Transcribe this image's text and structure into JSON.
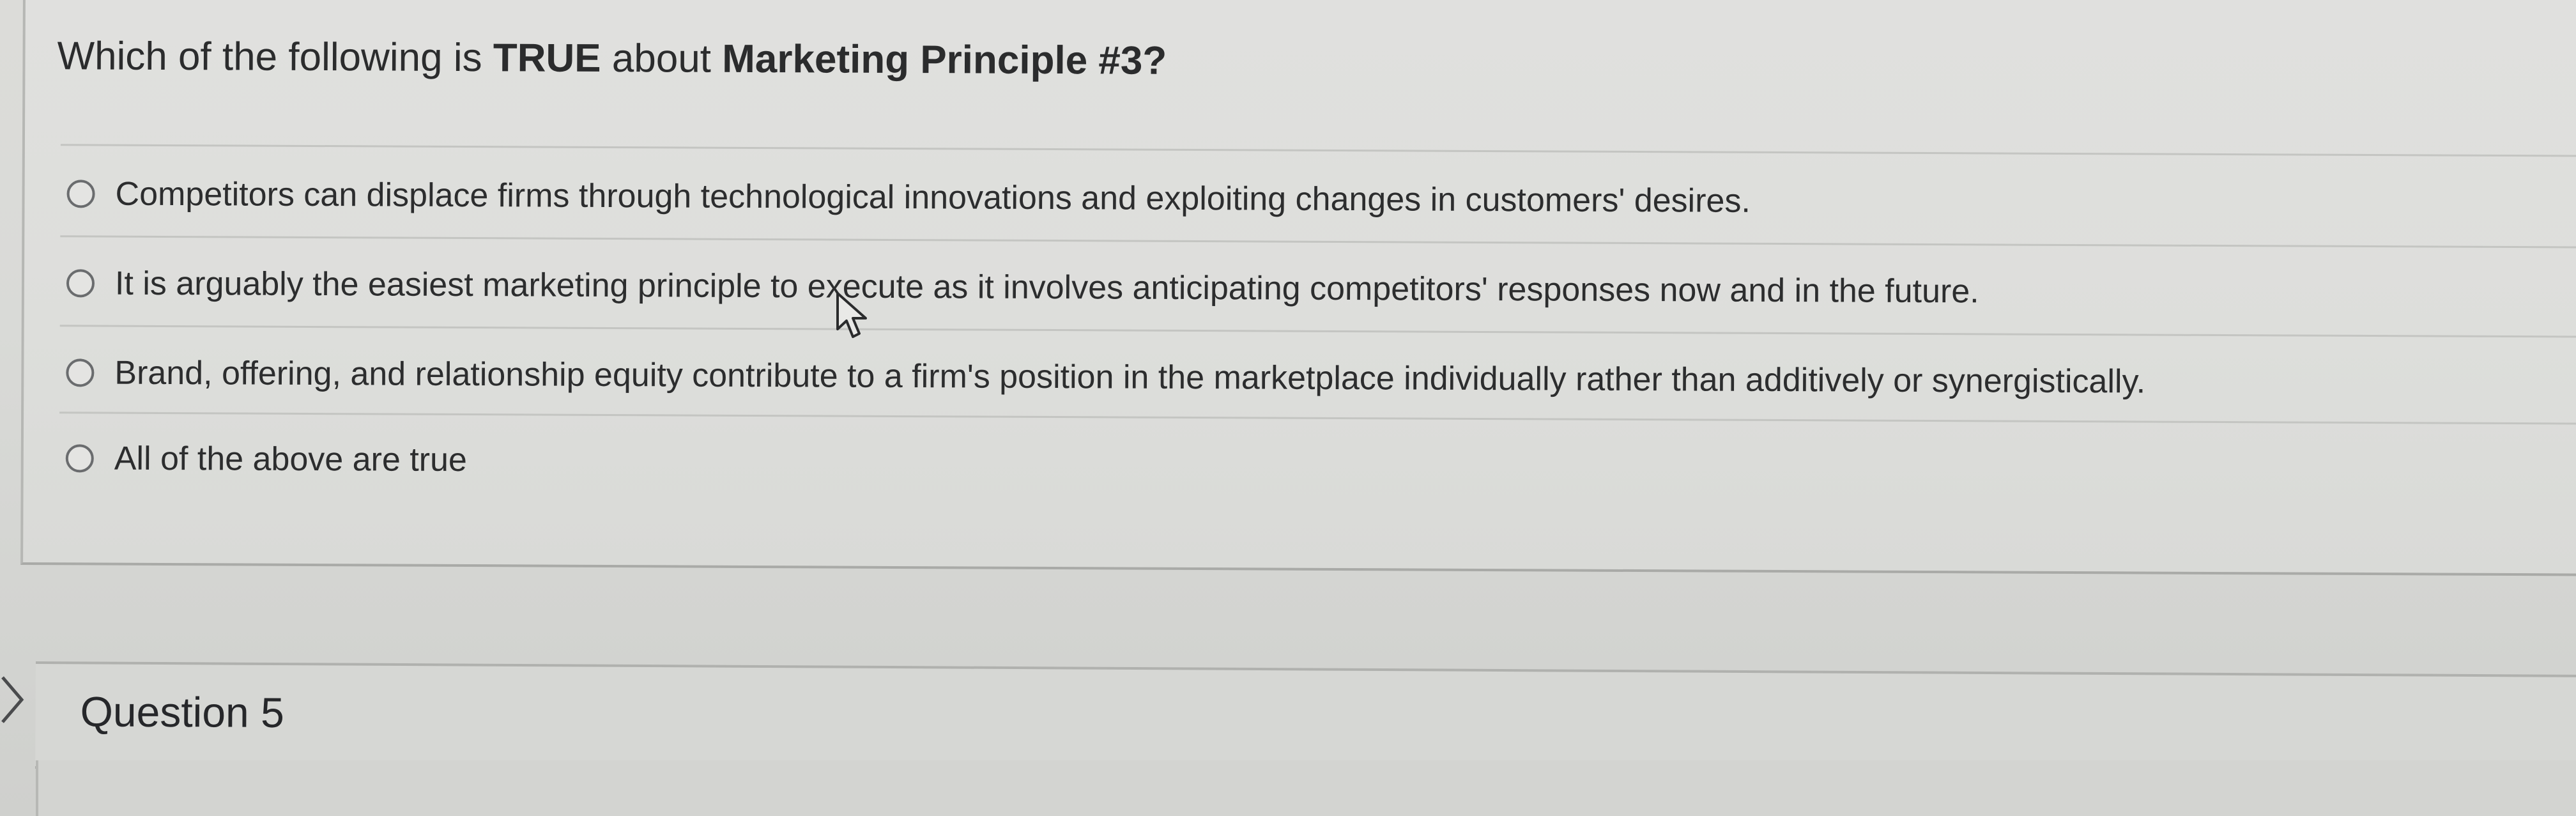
{
  "question": {
    "prefix": "Which of the following is ",
    "emphasis": "TRUE",
    "middle": " about ",
    "topic": "Marketing Principle #3?"
  },
  "options": [
    {
      "label": "Competitors can displace firms through technological innovations and exploiting changes in customers' desires."
    },
    {
      "label": "It is arguably the easiest marketing principle to execute as it involves anticipating competitors' responses now and in the future."
    },
    {
      "label": "Brand, offering, and relationship equity contribute to a firm's position in the marketplace individually rather than additively or synergistically."
    },
    {
      "label": "All of the above are true"
    }
  ],
  "next_question": {
    "title": "Question 5"
  },
  "icons": {
    "radio": "radio-button-icon",
    "expand": "chevron-right-icon",
    "pointer": "mouse-cursor-icon"
  }
}
